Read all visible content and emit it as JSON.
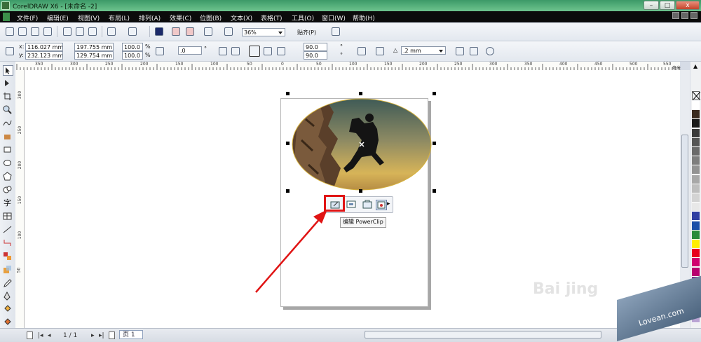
{
  "window": {
    "title": "CorelDRAW X6 - [未命名 -2]",
    "min": "–",
    "max": "□",
    "close": "x"
  },
  "menu": [
    "文件(F)",
    "编辑(E)",
    "视图(V)",
    "布局(L)",
    "排列(A)",
    "效果(C)",
    "位图(B)",
    "文本(X)",
    "表格(T)",
    "工具(O)",
    "窗口(W)",
    "帮助(H)"
  ],
  "standard_toolbar": {
    "zoom": "36%",
    "snap_label": "贴齐(P)"
  },
  "property_bar": {
    "x_label": "x:",
    "x_value": "116.027 mm",
    "y_label": "y:",
    "y_value": "232.123 mm",
    "w_value": "197.755 mm",
    "h_value": "129.754 mm",
    "scale_w": "100.0",
    "scale_h": "100.0",
    "pct": "%",
    "angle": ".0",
    "degree": "°",
    "angle2": "90.0",
    "angle3": "90.0",
    "outline_width": ".2 mm"
  },
  "ruler": {
    "top": [
      "350",
      "300",
      "250",
      "200",
      "150",
      "100",
      "50",
      "0",
      "50",
      "100",
      "150",
      "200",
      "250",
      "300",
      "350",
      "400",
      "450",
      "500",
      "550"
    ],
    "top_unit": "毫米",
    "left": [
      "300",
      "250",
      "200",
      "150",
      "100",
      "50"
    ]
  },
  "context_toolbar": {
    "tooltip": "编辑 PowerClip",
    "arrow": "▸"
  },
  "status": {
    "page_count": "1 / 1",
    "page_tab": "页 1"
  },
  "watermarks": {
    "brand": "Lovean.com",
    "faint": "Bai jing"
  },
  "colors": {
    "title_green": "#4fae78",
    "highlight_red": "#e01414",
    "selection": "#000000"
  },
  "palette": [
    "#ffffff",
    "#3a2a1e",
    "#1a1a1a",
    "#3a3a3a",
    "#555555",
    "#6a6a6a",
    "#7e7e7e",
    "#939393",
    "#a8a8a8",
    "#bebebe",
    "#d3d3d3",
    "#e8e8e8",
    "#2f3ea2",
    "#1b4fa8",
    "#2a8c3a",
    "#ffee00",
    "#e8001d",
    "#d0006f",
    "#b8006f",
    "#7b2a8a",
    "#e07a10",
    "#c5a27e",
    "#9d8062",
    "#b9a3d3"
  ]
}
